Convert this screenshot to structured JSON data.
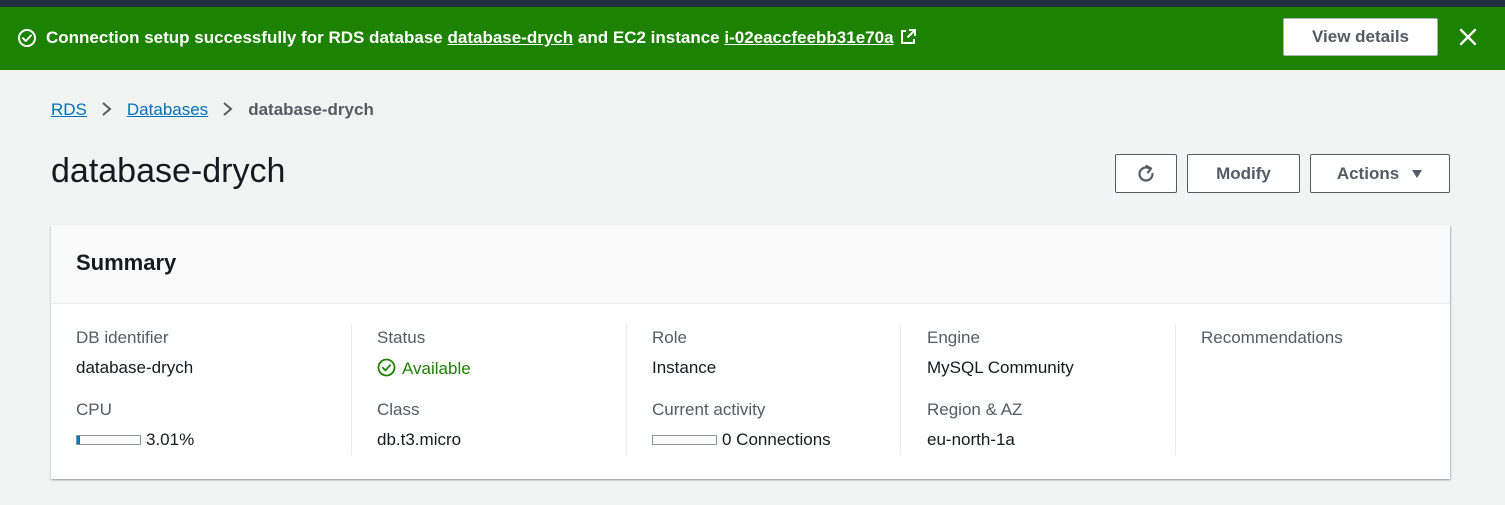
{
  "flash": {
    "prefix": "Connection setup successfully for RDS database",
    "db_link": "database-drych",
    "middle": "and EC2 instance",
    "ec2_link": "i-02eaccfeebb31e70a",
    "view_details_label": "View details",
    "color": "#1d8102"
  },
  "breadcrumbs": {
    "rds": "RDS",
    "databases": "Databases",
    "current": "database-drych"
  },
  "page": {
    "title": "database-drych"
  },
  "toolbar": {
    "refresh_icon": "refresh-icon",
    "modify_label": "Modify",
    "actions_label": "Actions"
  },
  "summary": {
    "title": "Summary",
    "db_identifier_label": "DB identifier",
    "db_identifier_value": "database-drych",
    "cpu_label": "CPU",
    "cpu_value": "3.01%",
    "cpu_fraction": 0.0301,
    "status_label": "Status",
    "status_value": "Available",
    "class_label": "Class",
    "class_value": "db.t3.micro",
    "role_label": "Role",
    "role_value": "Instance",
    "activity_label": "Current activity",
    "activity_value": "0 Connections",
    "activity_fraction": 0,
    "engine_label": "Engine",
    "engine_value": "MySQL Community",
    "region_label": "Region & AZ",
    "region_value": "eu-north-1a",
    "recommendations_label": "Recommendations"
  },
  "colors": {
    "link": "#0073bb",
    "success": "#1d8102",
    "header_dark": "#232f3e"
  }
}
